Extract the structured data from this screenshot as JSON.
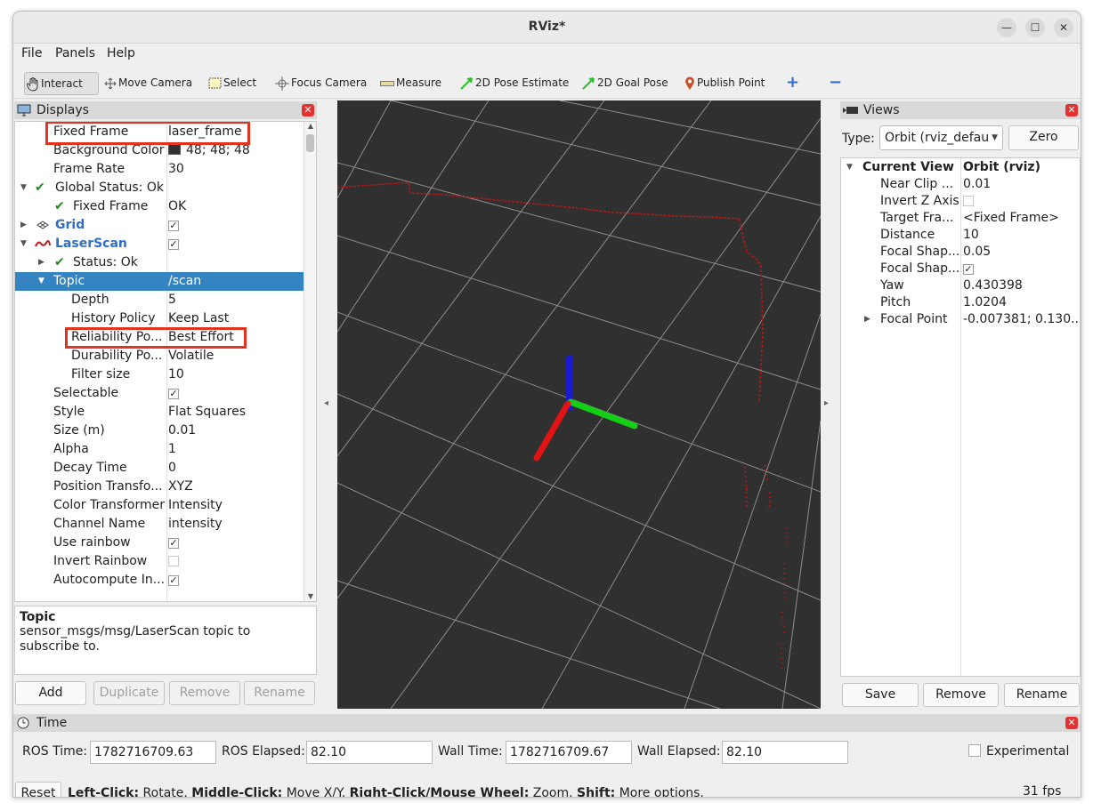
{
  "window": {
    "title": "RViz*"
  },
  "menu": {
    "file": "File",
    "panels": "Panels",
    "help": "Help"
  },
  "toolbar": {
    "interact": "Interact",
    "move_camera": "Move Camera",
    "select": "Select",
    "focus_camera": "Focus Camera",
    "measure": "Measure",
    "pose_estimate": "2D Pose Estimate",
    "goal_pose": "2D Goal Pose",
    "publish_point": "Publish Point",
    "add_tool": "+",
    "remove_tool": "−"
  },
  "displays": {
    "title": "Displays",
    "rows": [
      {
        "label": "Fixed Frame",
        "value": "laser_frame"
      },
      {
        "label": "Background Color",
        "value": "48; 48; 48"
      },
      {
        "label": "Frame Rate",
        "value": "30"
      },
      {
        "label": "Global Status: Ok",
        "value": ""
      },
      {
        "label": "Fixed Frame",
        "value": "OK"
      },
      {
        "label": "Grid",
        "value": ""
      },
      {
        "label": "LaserScan",
        "value": ""
      },
      {
        "label": "Status: Ok",
        "value": ""
      },
      {
        "label": "Topic",
        "value": "/scan"
      },
      {
        "label": "Depth",
        "value": "5"
      },
      {
        "label": "History Policy",
        "value": "Keep Last"
      },
      {
        "label": "Reliability Po...",
        "value": "Best Effort"
      },
      {
        "label": "Durability Po...",
        "value": "Volatile"
      },
      {
        "label": "Filter size",
        "value": "10"
      },
      {
        "label": "Selectable",
        "value": ""
      },
      {
        "label": "Style",
        "value": "Flat Squares"
      },
      {
        "label": "Size (m)",
        "value": "0.01"
      },
      {
        "label": "Alpha",
        "value": "1"
      },
      {
        "label": "Decay Time",
        "value": "0"
      },
      {
        "label": "Position Transfo...",
        "value": "XYZ"
      },
      {
        "label": "Color Transformer",
        "value": "Intensity"
      },
      {
        "label": "Channel Name",
        "value": "intensity"
      },
      {
        "label": "Use rainbow",
        "value": ""
      },
      {
        "label": "Invert Rainbow",
        "value": ""
      },
      {
        "label": "Autocompute In...",
        "value": ""
      }
    ],
    "checkboxes": {
      "grid": true,
      "laserscan": true,
      "selectable": true,
      "use_rainbow": true,
      "invert_rainbow": false,
      "autocompute": true
    },
    "bg_color": "#303030",
    "description": {
      "title": "Topic",
      "text": "sensor_msgs/msg/LaserScan topic to subscribe to."
    },
    "buttons": {
      "add": "Add",
      "duplicate": "Duplicate",
      "remove": "Remove",
      "rename": "Rename"
    }
  },
  "views": {
    "title": "Views",
    "type_label": "Type:",
    "type_value": "Orbit (rviz_defau",
    "zero": "Zero",
    "header": {
      "label": "Current View",
      "value": "Orbit (rviz)"
    },
    "rows": [
      {
        "label": "Near Clip ...",
        "value": "0.01"
      },
      {
        "label": "Invert Z Axis",
        "value": ""
      },
      {
        "label": "Target Fra...",
        "value": "<Fixed Frame>"
      },
      {
        "label": "Distance",
        "value": "10"
      },
      {
        "label": "Focal Shap...",
        "value": "0.05"
      },
      {
        "label": "Focal Shap...",
        "value": ""
      },
      {
        "label": "Yaw",
        "value": "0.430398"
      },
      {
        "label": "Pitch",
        "value": "1.0204"
      },
      {
        "label": "Focal Point",
        "value": "-0.007381; 0.130..."
      }
    ],
    "invert_z": false,
    "focal_shape_fixed": true,
    "buttons": {
      "save": "Save",
      "remove": "Remove",
      "rename": "Rename"
    }
  },
  "time": {
    "title": "Time",
    "ros_time_label": "ROS Time:",
    "ros_time": "1782716709.63",
    "ros_elapsed_label": "ROS Elapsed:",
    "ros_elapsed": "82.10",
    "wall_time_label": "Wall Time:",
    "wall_time": "1782716709.67",
    "wall_elapsed_label": "Wall Elapsed:",
    "wall_elapsed": "82.10",
    "experimental": "Experimental",
    "experimental_checked": false
  },
  "status": {
    "reset": "Reset",
    "hint_left_bold": "Left-Click:",
    "hint_left": " Rotate. ",
    "hint_middle_bold": "Middle-Click:",
    "hint_middle": " Move X/Y. ",
    "hint_right_bold": "Right-Click/Mouse Wheel:",
    "hint_right": " Zoom. ",
    "hint_shift_bold": "Shift:",
    "hint_shift": " More options.",
    "fps": "31 fps"
  },
  "colors": {
    "selection": "#3384c1",
    "highlight": "#e2341d",
    "scan": "#c01818",
    "axis_x": "#e01010",
    "axis_y": "#10d010",
    "axis_z": "#1010c8"
  }
}
